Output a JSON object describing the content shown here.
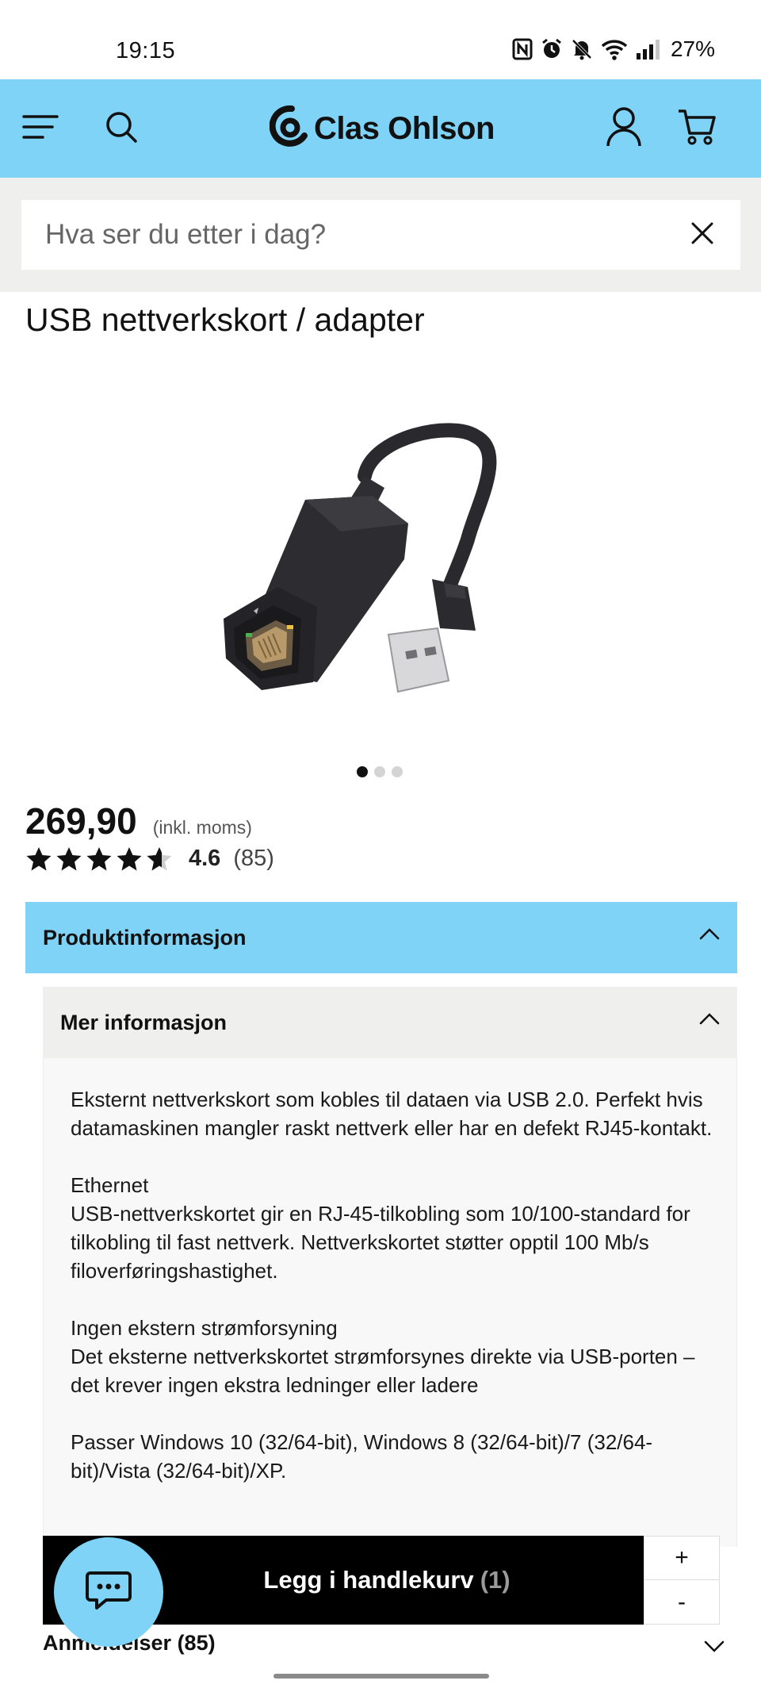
{
  "status_bar": {
    "time": "19:15",
    "battery": "27%",
    "icons": [
      "nfc-icon",
      "alarm-icon",
      "mute-icon",
      "wifi-icon",
      "signal-icon"
    ]
  },
  "header": {
    "brand": "Clas Ohlson",
    "background": "#7fd3f6",
    "icons": [
      "menu-icon",
      "search-icon",
      "user-icon",
      "cart-icon"
    ]
  },
  "search": {
    "placeholder": "Hva ser du etter i dag?",
    "value": ""
  },
  "product": {
    "title": "USB nettverkskort / adapter",
    "price": "269,90",
    "vat_note": "(inkl. moms)",
    "rating_value": "4.6",
    "rating_stars": 4.6,
    "rating_count": "(85)",
    "image_count": 3,
    "active_image": 1
  },
  "accordion": {
    "main_label": "Produktinformasjon",
    "sub_label": "Mer informasjon",
    "description": [
      "Eksternt nettverkskort som kobles til dataen via USB 2.0. Perfekt hvis datamaskinen mangler raskt nettverk eller har en defekt RJ45-kontakt.",
      "Ethernet",
      "USB-nettverkskortet gir en RJ-45-tilkobling som 10/100-standard for tilkobling til fast nettverk. Nettverkskortet støtter opptil 100 Mb/s filoverføringshastighet.",
      "Ingen ekstern strømforsyning",
      "Det eksterne nettverkskortet strømforsynes direkte via USB-porten – det krever ingen ekstra ledninger eller ladere",
      "Passer Windows 10 (32/64-bit), Windows 8 (32/64-bit)/7 (32/64-bit)/Vista (32/64-bit)/XP."
    ],
    "reviews_label": "Anmeldelser (85)"
  },
  "cart": {
    "label": "Legg i handlekurv",
    "count": "(1)",
    "plus": "+",
    "minus": "-"
  }
}
